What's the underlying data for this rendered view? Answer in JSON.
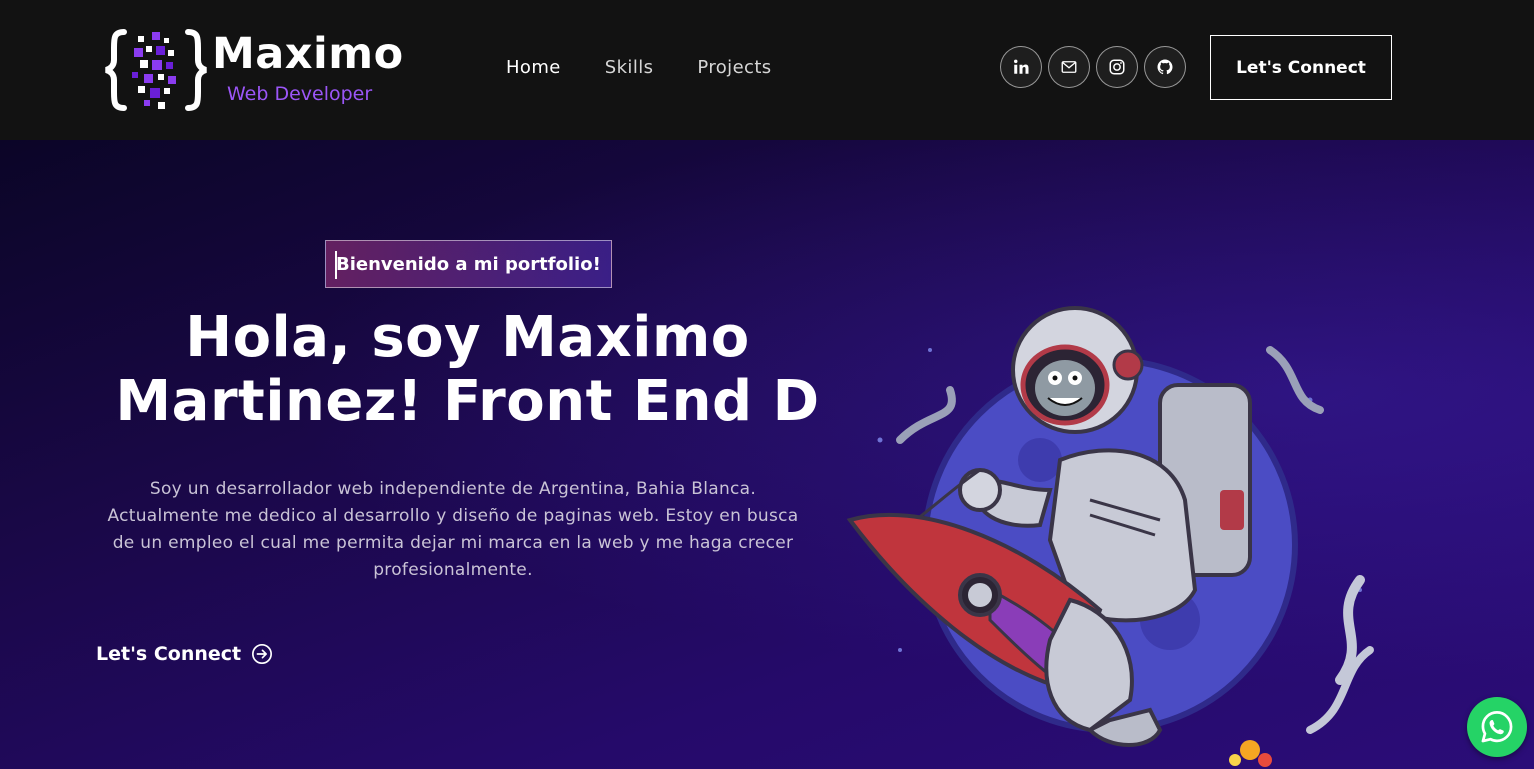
{
  "brand": {
    "name": "Maximo",
    "subtitle": "Web Developer"
  },
  "nav": {
    "items": [
      {
        "label": "Home"
      },
      {
        "label": "Skills"
      },
      {
        "label": "Projects"
      }
    ]
  },
  "socials": [
    {
      "icon": "linkedin-icon"
    },
    {
      "icon": "mail-icon"
    },
    {
      "icon": "instagram-icon"
    },
    {
      "icon": "github-icon"
    }
  ],
  "header": {
    "connect_label": "Let's Connect"
  },
  "hero": {
    "tagline": "Bienvenido a mi portfolio!",
    "headline_line1": "Hola, soy Maximo",
    "headline_line2": "Martinez! Front End D",
    "bio_line1": "Soy un desarrollador web independiente de Argentina, Bahia Blanca.",
    "bio_line2": "Actualmente me dedico al desarrollo y diseño de paginas web. Estoy en busca",
    "bio_line3": "de un empleo el cual me permita dejar mi marca en la web y me haga crecer",
    "bio_line4": "profesionalmente.",
    "cta_label": "Let's Connect"
  },
  "colors": {
    "navbar_bg": "#121212",
    "accent_purple": "#9b56f7",
    "hero_bg_start": "#0b0527",
    "hero_bg_end": "#2b0d78",
    "whatsapp_green": "#25d366"
  }
}
